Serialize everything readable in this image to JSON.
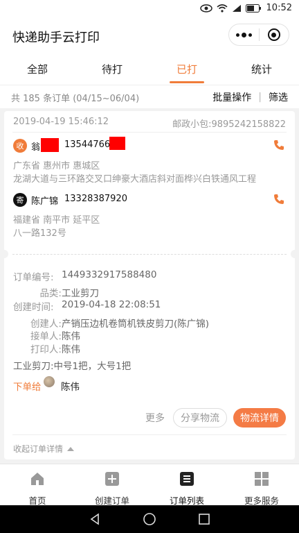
{
  "status_bar": {
    "time": "10:52",
    "icons": [
      "eye-icon",
      "wifi-icon",
      "signal-icon",
      "battery-icon"
    ]
  },
  "header": {
    "title": "快递助手云打印"
  },
  "tabs": [
    {
      "label": "全部",
      "active": false
    },
    {
      "label": "待打",
      "active": false
    },
    {
      "label": "已打",
      "active": true
    },
    {
      "label": "统计",
      "active": false
    }
  ],
  "summary": {
    "text": "共 185 条订单 (04/15~06/04)",
    "batch": "批量操作",
    "filter": "筛选"
  },
  "order": {
    "date": "2019-04-19 15:46:12",
    "waybill": "邮政小包:9895242158822",
    "receiver": {
      "badge": "收",
      "name": "翁",
      "phone": "13544766",
      "region": "广东省 惠州市 惠城区",
      "address": "龙湖大道与三环路交叉口绅豪大酒店斜对面桦兴白铁通风工程"
    },
    "sender": {
      "badge": "寄",
      "name": "陈广锦",
      "phone": "13328387920",
      "region": "福建省 南平市 延平区",
      "address": "八一路132号"
    },
    "details": {
      "order_no_label": "订单编号:",
      "order_no": "1449332917588480",
      "category_label": "品类:",
      "category": "工业剪刀",
      "created_label": "创建时间:",
      "created": "2019-04-18 22:08:51",
      "creator_label": "创建人:",
      "creator": "产销压边机卷筒机铁皮剪刀(陈广锦)",
      "receiver_op_label": "接单人:",
      "receiver_op": "陈伟",
      "printer_label": "打印人:",
      "printer": "陈伟",
      "items": "工业剪刀:中号1把，大号1把"
    },
    "assigned_label": "下单给",
    "assigned_to": "陈伟",
    "actions": {
      "more": "更多",
      "share": "分享物流",
      "logistics": "物流详情"
    },
    "collapse": "收起订单详情"
  },
  "bottom_nav": [
    {
      "label": "首页",
      "icon": "home-icon"
    },
    {
      "label": "创建订单",
      "icon": "plus-square-icon"
    },
    {
      "label": "订单列表",
      "icon": "list-icon"
    },
    {
      "label": "更多服务",
      "icon": "grid-icon"
    }
  ],
  "colors": {
    "accent": "#f07c3a",
    "button": "#f47b45",
    "redaction": "#ff0000"
  }
}
